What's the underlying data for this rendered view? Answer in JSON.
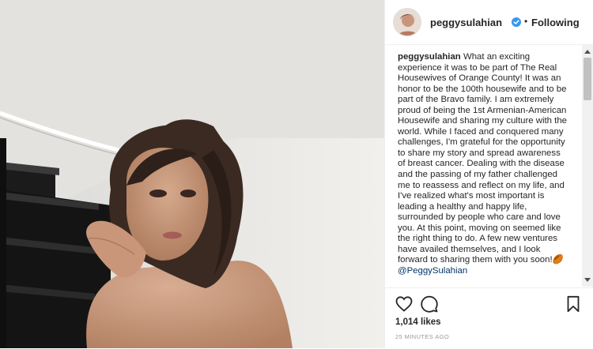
{
  "profile": {
    "username": "peggysulahian",
    "separator": "•",
    "follow_status": "Following"
  },
  "caption": {
    "author": "peggysulahian",
    "text": "What an exciting experience it was to be part of The Real Housewives of Orange County! It was an honor to be the 100th housewife and to be part of the Bravo family. I am extremely proud of being the 1st Armenian-American Housewife and sharing my culture with the world. While I faced and conquered many challenges, I'm grateful for the opportunity to share my story and spread awareness of breast cancer. Dealing with the disease and the passing of my father challenged me to reassess and reflect on my life, and I've realized what's most important is leading a healthy and happy life, surrounded by people who care and love you. At this point, moving on seemed like the right thing to do. A few new ventures have availed themselves, and I look forward to sharing them with you soon!",
    "emoji": "🏉",
    "mention": "@PeggySulahian"
  },
  "stats": {
    "likes": "1,014 likes",
    "timestamp": "25 MINUTES AGO"
  },
  "icons": {
    "like": "heart-icon",
    "comment": "comment-icon",
    "save": "bookmark-icon",
    "verified": "verified-badge-icon"
  },
  "colors": {
    "verified_blue": "#3897f0",
    "mention": "#003569",
    "text": "#262626",
    "muted": "#999999"
  }
}
